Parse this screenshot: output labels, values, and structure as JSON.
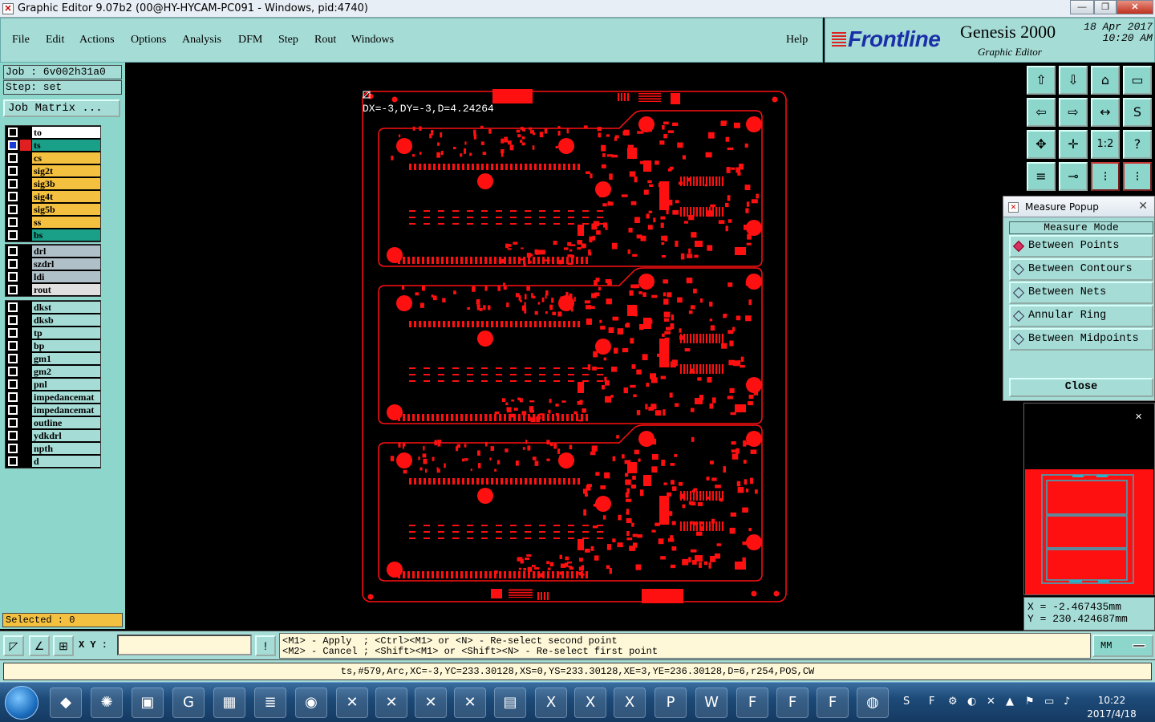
{
  "window": {
    "title": "Graphic Editor 9.07b2 (00@HY-HYCAM-PC091 - Windows, pid:4740)",
    "min": "—",
    "max": "❐",
    "close": "✕"
  },
  "menu": {
    "items": [
      "File",
      "Edit",
      "Actions",
      "Options",
      "Analysis",
      "DFM",
      "Step",
      "Rout",
      "Windows"
    ],
    "help": "Help"
  },
  "brand": {
    "logo": "Frontline",
    "name": "Genesis 2000",
    "subtitle": "Graphic Editor",
    "date": "18 Apr 2017",
    "time": "10:20 AM"
  },
  "job": {
    "job_line": "Job : 6v002h31a0",
    "step_line": "Step: set",
    "matrix_button": "Job Matrix ..."
  },
  "layers": {
    "group1": [
      {
        "name": "to",
        "color": "#ffffff"
      },
      {
        "name": "ts",
        "color": "#1aa088",
        "work": true
      },
      {
        "name": "cs",
        "color": "#f4c040"
      },
      {
        "name": "sig2t",
        "color": "#f4c040"
      },
      {
        "name": "sig3b",
        "color": "#f4c040"
      },
      {
        "name": "sig4t",
        "color": "#f4c040"
      },
      {
        "name": "sig5b",
        "color": "#f4c040"
      },
      {
        "name": "ss",
        "color": "#f4c040"
      },
      {
        "name": "bs",
        "color": "#1aa088"
      }
    ],
    "group2": [
      {
        "name": "drl",
        "color": "#b0c0c8"
      },
      {
        "name": "szdrl",
        "color": "#b0c0c8"
      },
      {
        "name": "ldi",
        "color": "#b0c0c8"
      },
      {
        "name": "rout",
        "color": "#e0e0e0"
      }
    ],
    "group3": [
      {
        "name": "dkst",
        "color": "#a6dcd6"
      },
      {
        "name": "dksb",
        "color": "#a6dcd6"
      },
      {
        "name": "tp",
        "color": "#a6dcd6"
      },
      {
        "name": "bp",
        "color": "#a6dcd6"
      },
      {
        "name": "gm1",
        "color": "#a6dcd6"
      },
      {
        "name": "gm2",
        "color": "#a6dcd6"
      },
      {
        "name": "pnl",
        "color": "#a6dcd6"
      },
      {
        "name": "impedancemat",
        "color": "#a6dcd6"
      },
      {
        "name": "impedancemat",
        "color": "#a6dcd6"
      },
      {
        "name": "outline",
        "color": "#a6dcd6"
      },
      {
        "name": "ydkdrl",
        "color": "#a6dcd6"
      },
      {
        "name": "npth",
        "color": "#a6dcd6"
      },
      {
        "name": "d",
        "color": "#a6dcd6"
      }
    ]
  },
  "selected": "Selected : 0",
  "canvas": {
    "readout": "DX=-3,DY=-3,D=4.24264",
    "copper_color": "#ff1010"
  },
  "measure": {
    "title": "Measure Popup",
    "mode_label": "Measure Mode",
    "options": [
      "Between Points",
      "Between Contours",
      "Between Nets",
      "Annular Ring",
      "Between Midpoints"
    ],
    "selected_option": "Between Points",
    "close": "Close"
  },
  "coords": {
    "x": "X = -2.467435mm",
    "y": "Y = 230.424687mm"
  },
  "bottom": {
    "xy_label": "X Y :",
    "xy_value": "",
    "hint1": "<M1> - Apply  ; <Ctrl><M1> or <N> - Re-select second point",
    "hint2": "<M2> - Cancel ; <Shift><M1> or <Shift><N> - Re-select first point",
    "units": "MM",
    "status": "ts,#579,Arc,XC=-3,YC=233.30128,XS=0,YS=233.30128,XE=3,YE=236.30128,D=6,r254,POS,CW"
  },
  "taskbar": {
    "time": "10:22",
    "date": "2017/4/18"
  }
}
